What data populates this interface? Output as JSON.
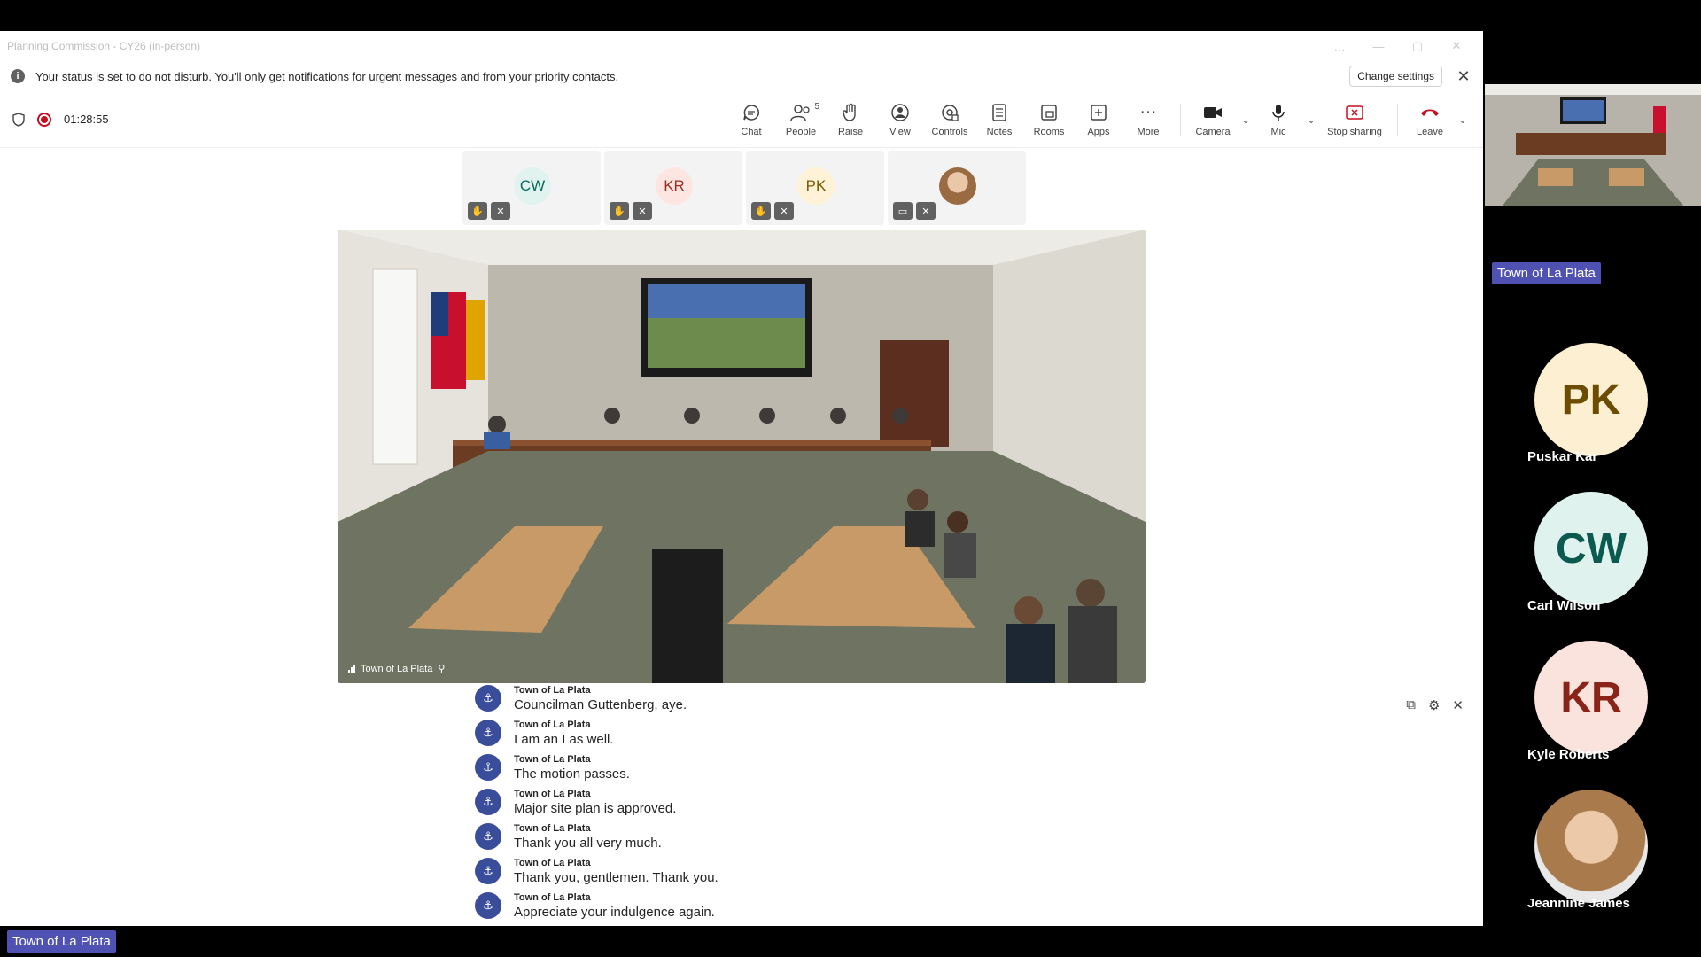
{
  "window": {
    "title": "Planning Commission - CY26 (in-person)",
    "controls": [
      "…",
      "—",
      "▢",
      "✕"
    ]
  },
  "banner": {
    "message": "Your status is set to do not disturb. You'll only get notifications for urgent messages and from your priority contacts.",
    "change_settings": "Change settings"
  },
  "meeting": {
    "timer": "01:28:55"
  },
  "toolbar": {
    "chat": "Chat",
    "people": "People",
    "people_count": "5",
    "raise": "Raise",
    "view": "View",
    "controls": "Controls",
    "notes": "Notes",
    "rooms": "Rooms",
    "apps": "Apps",
    "more": "More",
    "camera": "Camera",
    "mic": "Mic",
    "stop_sharing": "Stop sharing",
    "leave": "Leave"
  },
  "participant_tiles": [
    {
      "initials": "CW",
      "bg": "#e0f3ef",
      "fg": "#0b6a5e"
    },
    {
      "initials": "KR",
      "bg": "#fde6e1",
      "fg": "#9e2d1f"
    },
    {
      "initials": "PK",
      "bg": "#fff2d6",
      "fg": "#7a5a00"
    },
    {
      "initials": "",
      "photo": true
    }
  ],
  "video": {
    "label": "Town of La Plata"
  },
  "captions": [
    {
      "speaker": "Town of La Plata",
      "text": "Councilman Guttenberg, aye."
    },
    {
      "speaker": "Town of La Plata",
      "text": "I am an I as well."
    },
    {
      "speaker": "Town of La Plata",
      "text": "The motion passes."
    },
    {
      "speaker": "Town of La Plata",
      "text": "Major site plan is approved."
    },
    {
      "speaker": "Town of La Plata",
      "text": "Thank you all very much."
    },
    {
      "speaker": "Town of La Plata",
      "text": "Thank you, gentlemen. Thank you."
    },
    {
      "speaker": "Town of La Plata",
      "text": "Appreciate your indulgence again."
    }
  ],
  "bottom_label": "Town of La Plata",
  "right_panel": {
    "thumb_label": "Town of La Plata",
    "people": [
      {
        "initials": "PK",
        "name": "Puskar Kar",
        "bg": "#fdf0d2",
        "fg": "#6b4c00"
      },
      {
        "initials": "CW",
        "name": "Carl Wilson",
        "bg": "#dff2ee",
        "fg": "#0a5a50"
      },
      {
        "initials": "KR",
        "name": "Kyle Roberts",
        "bg": "#fbe3dd",
        "fg": "#8a2418"
      },
      {
        "initials": "",
        "name": "Jeannine James",
        "photo": true
      }
    ]
  }
}
